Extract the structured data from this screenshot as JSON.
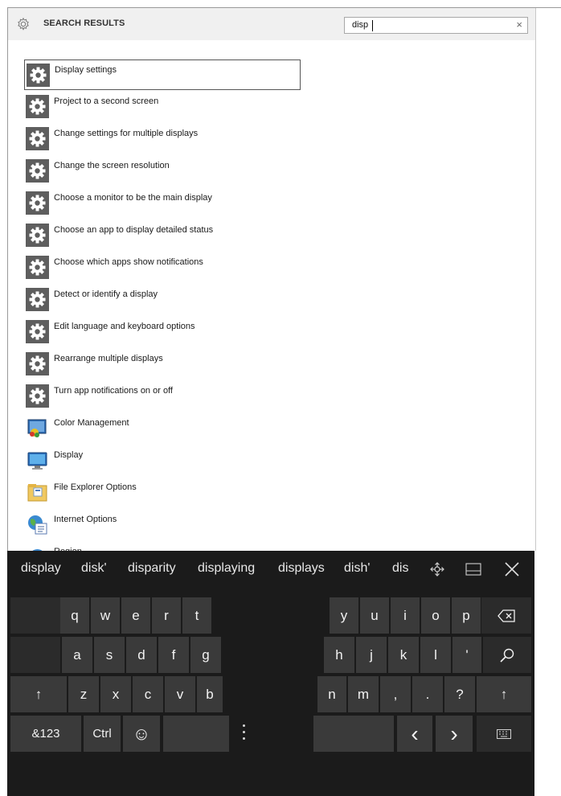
{
  "header": {
    "title": "SEARCH RESULTS",
    "search_value": "disp",
    "clear_glyph": "×",
    "icon": "gear-icon"
  },
  "results": [
    {
      "label": "Display settings",
      "icon": "gear-icon",
      "selected": true
    },
    {
      "label": "Project to a second screen",
      "icon": "gear-icon"
    },
    {
      "label": "Change settings for multiple displays",
      "icon": "gear-icon"
    },
    {
      "label": "Change the screen resolution",
      "icon": "gear-icon"
    },
    {
      "label": "Choose a monitor to be the main display",
      "icon": "gear-icon"
    },
    {
      "label": "Choose an app to display detailed status",
      "icon": "gear-icon"
    },
    {
      "label": "Choose which apps show notifications",
      "icon": "gear-icon"
    },
    {
      "label": "Detect or identify a display",
      "icon": "gear-icon"
    },
    {
      "label": "Edit language and keyboard options",
      "icon": "gear-icon"
    },
    {
      "label": "Rearrange multiple displays",
      "icon": "gear-icon"
    },
    {
      "label": "Turn app notifications on or off",
      "icon": "gear-icon"
    },
    {
      "label": "Color Management",
      "icon": "color-management-icon"
    },
    {
      "label": "Display",
      "icon": "display-monitor-icon"
    },
    {
      "label": "File Explorer Options",
      "icon": "folder-options-icon"
    },
    {
      "label": "Internet Options",
      "icon": "internet-options-icon"
    },
    {
      "label": "Region",
      "icon": "region-globe-icon"
    }
  ],
  "keyboard": {
    "suggestions": [
      "display",
      "disk'",
      "disparity",
      "displaying",
      "displays",
      "dish'",
      "dis"
    ],
    "toolbar_icons": [
      "keyboard-move-icon",
      "keyboard-dock-icon",
      "close-keyboard-icon"
    ],
    "left_row1": [
      "q",
      "w",
      "e",
      "r",
      "t"
    ],
    "left_row2": [
      "a",
      "s",
      "d",
      "f",
      "g"
    ],
    "left_row3": [
      "z",
      "x",
      "c",
      "v",
      "b"
    ],
    "right_row1": [
      "y",
      "u",
      "i",
      "o",
      "p"
    ],
    "right_row2": [
      "h",
      "j",
      "k",
      "l",
      "'"
    ],
    "right_row3": [
      "n",
      "m",
      ",",
      ".",
      "?"
    ],
    "shift_glyph": "↑",
    "backspace_glyph": "⌫",
    "symbols_label": "&123",
    "ctrl_label": "Ctrl",
    "emoji_glyph": "☺",
    "left_arrow_glyph": "‹",
    "right_arrow_glyph": "›"
  },
  "colors": {
    "header_bg": "#f0f0f0",
    "keyboard_bg": "#1b1b1b",
    "key_bg": "#3a3a3a",
    "key_text": "#f2f2f2"
  }
}
